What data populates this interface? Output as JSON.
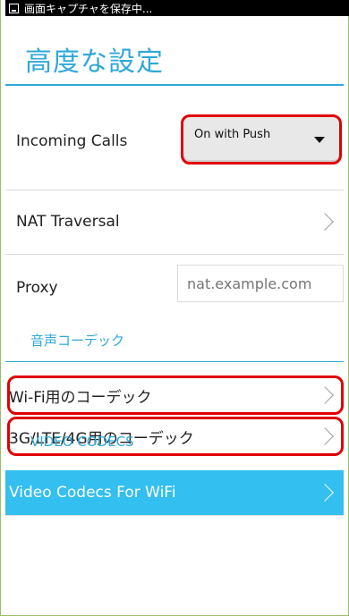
{
  "status_bar": {
    "text": "画面キャプチャを保存中..."
  },
  "page": {
    "title": "高度な設定"
  },
  "incoming_calls": {
    "label": "Incoming Calls",
    "value": "On with Push"
  },
  "nat_traversal": {
    "label": "NAT Traversal"
  },
  "proxy": {
    "label": "Proxy",
    "placeholder": "nat.example.com"
  },
  "audio_codecs": {
    "header": "音声コーデック",
    "wifi_label": "Wi-Fi用のコーデック",
    "mobile_label": "3G/LTE/4G用のコーデック"
  },
  "video_codecs": {
    "header": "VIDEO CODECS",
    "wifi_label": "Video Codecs For WiFi"
  },
  "colors": {
    "accent": "#2fa8d8",
    "highlight": "#e00000",
    "selected_row": "#33bff0"
  },
  "icons": {
    "status": "screenshot-icon",
    "dropdown": "caret-down-icon",
    "row": "chevron-right-icon"
  }
}
